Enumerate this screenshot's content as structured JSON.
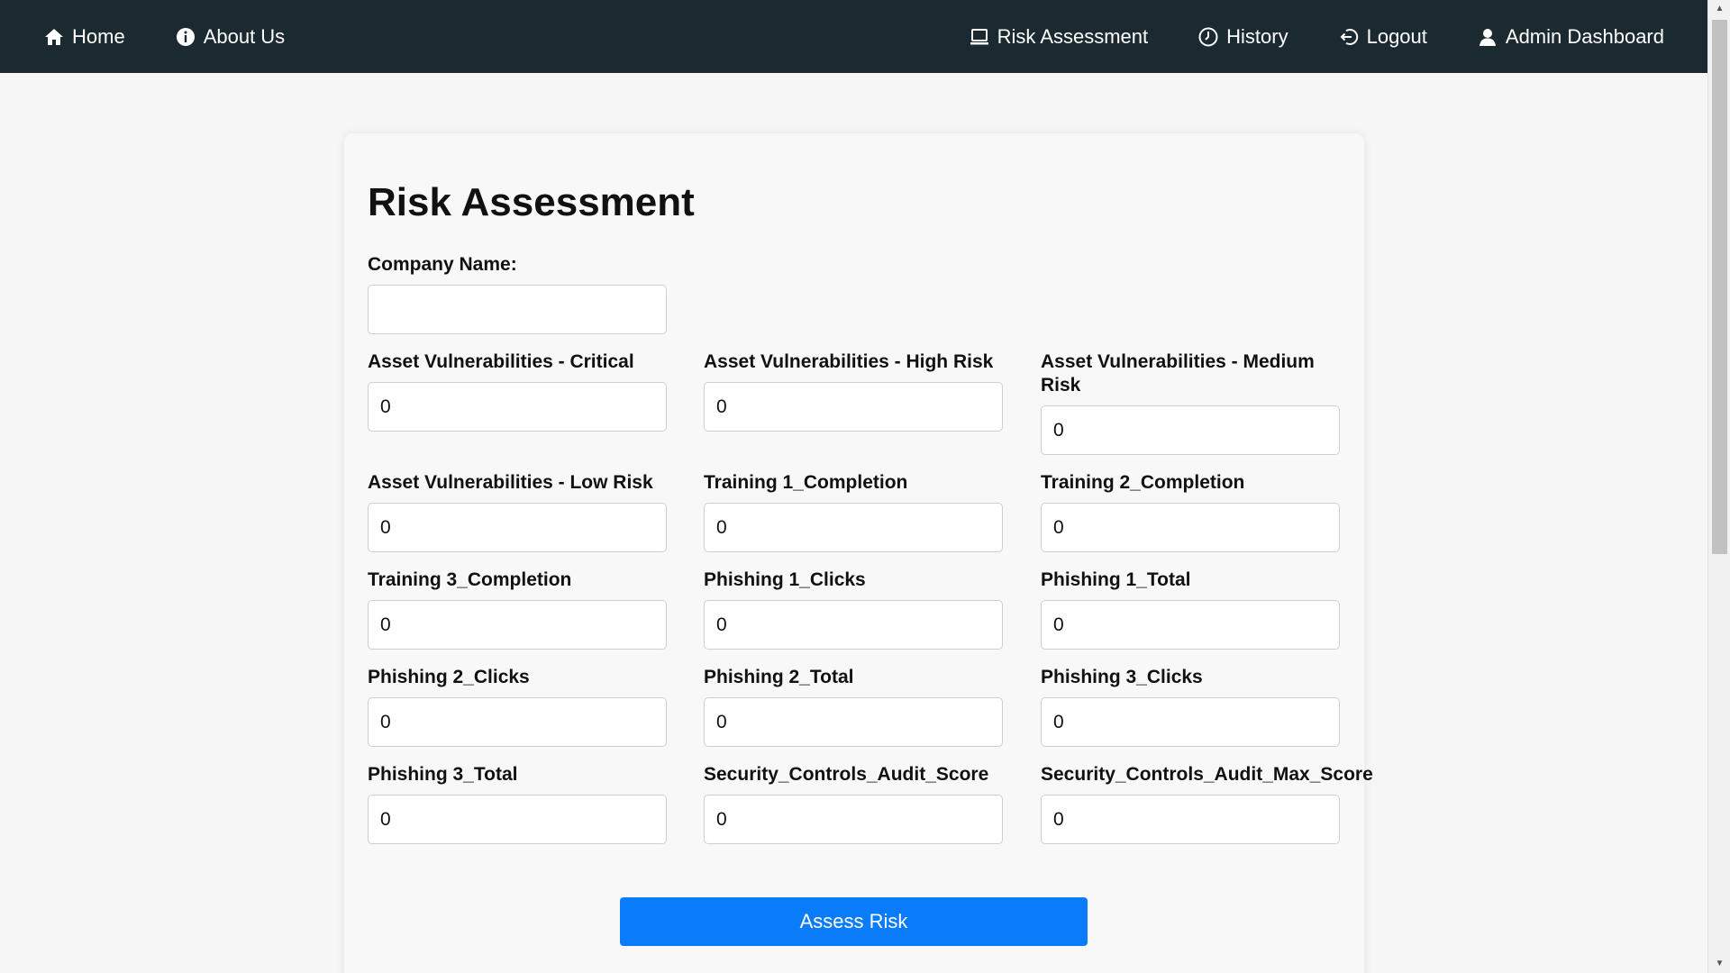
{
  "nav": {
    "left": [
      {
        "label": "Home",
        "icon": "home-icon"
      },
      {
        "label": "About Us",
        "icon": "info-icon"
      }
    ],
    "right": [
      {
        "label": "Risk Assessment",
        "icon": "laptop-icon"
      },
      {
        "label": "History",
        "icon": "clock-icon"
      },
      {
        "label": "Logout",
        "icon": "logout-icon"
      },
      {
        "label": "Admin Dashboard",
        "icon": "user-icon"
      }
    ]
  },
  "form": {
    "title": "Risk Assessment",
    "company_name": {
      "label": "Company Name:",
      "value": ""
    },
    "fields": [
      {
        "label": "Asset Vulnerabilities - Critical",
        "value": "0"
      },
      {
        "label": "Asset Vulnerabilities - High Risk",
        "value": "0"
      },
      {
        "label": "Asset Vulnerabilities - Medium Risk",
        "value": "0"
      },
      {
        "label": "Asset Vulnerabilities - Low Risk",
        "value": "0"
      },
      {
        "label": "Training 1_Completion",
        "value": "0"
      },
      {
        "label": "Training 2_Completion",
        "value": "0"
      },
      {
        "label": "Training 3_Completion",
        "value": "0"
      },
      {
        "label": "Phishing 1_Clicks",
        "value": "0"
      },
      {
        "label": "Phishing 1_Total",
        "value": "0"
      },
      {
        "label": "Phishing 2_Clicks",
        "value": "0"
      },
      {
        "label": "Phishing 2_Total",
        "value": "0"
      },
      {
        "label": "Phishing 3_Clicks",
        "value": "0"
      },
      {
        "label": "Phishing 3_Total",
        "value": "0"
      },
      {
        "label": "Security_Controls_Audit_Score",
        "value": "0"
      },
      {
        "label": "Security_Controls_Audit_Max_Score",
        "value": "0"
      }
    ],
    "submit_label": "Assess Risk"
  },
  "colors": {
    "navbar": "#1b2a30",
    "page_background": "#f6f6f7",
    "card_background": "#f8f8f8",
    "primary_button": "#0b7cf9"
  }
}
